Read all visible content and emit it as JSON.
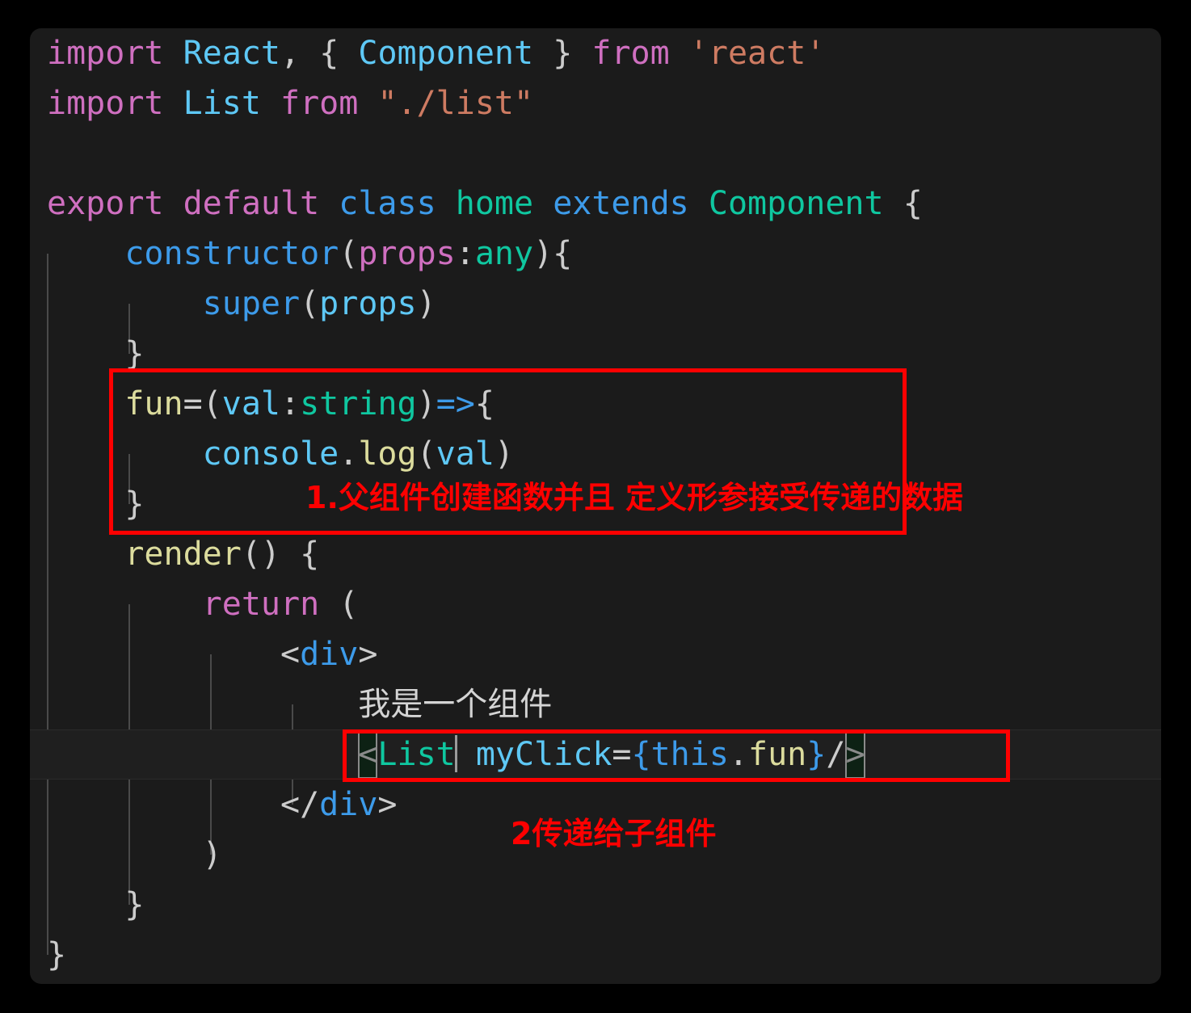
{
  "editor": {
    "language": "typescript-react",
    "theme_background": "#1b1b1b",
    "page_background": "#000000",
    "cursor_line_number": 16,
    "colors": {
      "keyword": "#cf6fc0",
      "control": "#3d9bea",
      "type": "#0fc7a0",
      "identifier": "#5ec8f5",
      "string": "#ce7b62",
      "function": "#dcdc9d",
      "punctuation": "#cccccc",
      "plain_text": "#d4d4d4",
      "annotation_red": "#fe0000",
      "bracket_match_fill": "#0d2114"
    }
  },
  "code": {
    "line_01": {
      "t1": "import",
      "t2": " ",
      "t3": "React",
      "t4": ", ",
      "t5": "{ ",
      "t6": "Component",
      "t7": " }",
      "t8": " ",
      "t9": "from",
      "t10": " ",
      "t11": "'react'"
    },
    "line_02": {
      "t1": "import",
      "t2": " ",
      "t3": "List",
      "t4": " ",
      "t5": "from",
      "t6": " ",
      "t7": "\"./list\""
    },
    "line_03": "",
    "line_04": {
      "t1": "export default",
      "t2": " ",
      "t3": "class",
      "t4": " ",
      "t5": "home",
      "t6": " ",
      "t7": "extends",
      "t8": " ",
      "t9": "Component",
      "t10": " {"
    },
    "line_05": {
      "indent": "    ",
      "t1": "constructor",
      "t2": "(",
      "t3": "props",
      "t4": ":",
      "t5": "any",
      "t6": "){"
    },
    "line_06": {
      "indent": "        ",
      "t1": "super",
      "t2": "(",
      "t3": "props",
      "t4": ")"
    },
    "line_07": {
      "indent": "    ",
      "t1": "}"
    },
    "line_08": {
      "indent": "    ",
      "t1": "fun",
      "t2": "=(",
      "t3": "val",
      "t4": ":",
      "t5": "string",
      "t6": ")",
      "t7": "=>",
      "t8": "{"
    },
    "line_09": {
      "indent": "        ",
      "t1": "console",
      "t2": ".",
      "t3": "log",
      "t4": "(",
      "t5": "val",
      "t6": ")"
    },
    "line_10": {
      "indent": "    ",
      "t1": "}"
    },
    "line_11": {
      "indent": "    ",
      "t1": "render",
      "t2": "() {"
    },
    "line_12": {
      "indent": "        ",
      "t1": "return",
      "t2": " ("
    },
    "line_13": {
      "indent": "            ",
      "t1": "<",
      "t2": "div",
      "t3": ">"
    },
    "line_14": {
      "indent": "                ",
      "t1": "我是一个组件"
    },
    "line_15": {
      "indent": "                ",
      "t1": "<",
      "t2": "List",
      "t3": " ",
      "t4": "myClick",
      "t5": "=",
      "t6": "{",
      "t7": "this",
      "t8": ".",
      "t9": "fun",
      "t10": "}",
      "t11": "/",
      "t12": ">"
    },
    "line_16": {
      "indent": "            ",
      "t1": "</",
      "t2": "div",
      "t3": ">"
    },
    "line_17": {
      "indent": "        ",
      "t1": ")"
    },
    "line_18": {
      "indent": "    ",
      "t1": "}"
    },
    "line_19": {
      "t1": "}"
    }
  },
  "annotations": [
    {
      "id": "annotation-1",
      "text": "1.父组件创建函数并且 定义形参接受传递的数据",
      "color": "#fe0000",
      "describes": "fun=(val:string)=>{ console.log(val) }"
    },
    {
      "id": "annotation-2",
      "text": "2传递给子组件",
      "color": "#fe0000",
      "describes": "<List myClick={this.fun}/>"
    }
  ],
  "highlight_boxes": [
    {
      "id": "redbox-1",
      "label": "parent-creates-function-box"
    },
    {
      "id": "redbox-2",
      "label": "pass-to-child-component-box"
    }
  ]
}
